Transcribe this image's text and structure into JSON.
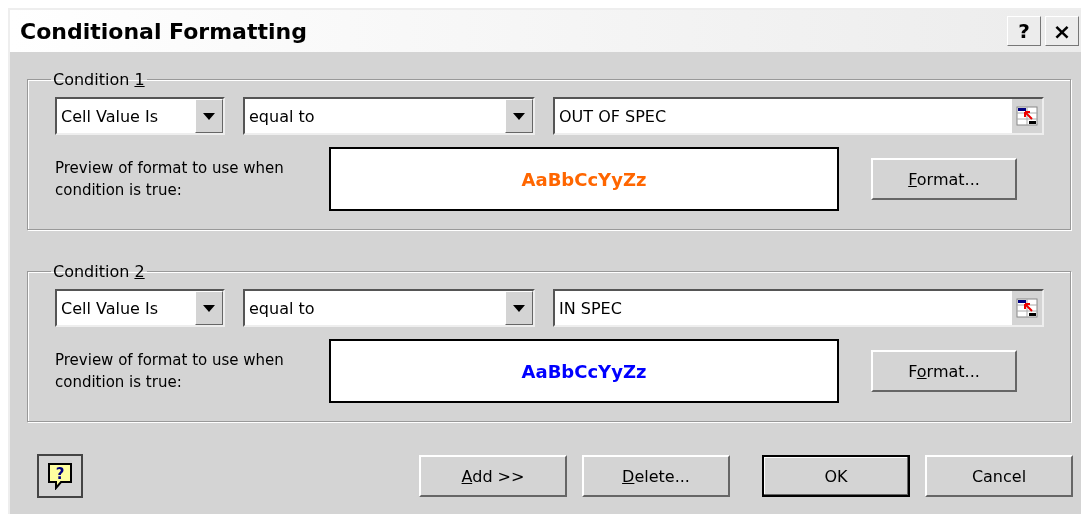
{
  "window": {
    "title": "Conditional Formatting"
  },
  "title_buttons": [
    {
      "kind": "help",
      "label": "?"
    },
    {
      "kind": "close",
      "label": "×"
    }
  ],
  "conditions": [
    {
      "title": "Condition ",
      "title_key": "1",
      "type": "Cell Value Is",
      "operator": "equal to",
      "value": "OUT OF SPEC",
      "preview_label": "Preview of format to use when condition is true:",
      "preview_text": "AaBbCcYyZz",
      "color": "#ff6600",
      "format_button": {
        "key": "F",
        "rest": "ormat..."
      }
    },
    {
      "title": "Condition ",
      "title_key": "2",
      "type": "Cell Value Is",
      "operator": "equal to",
      "value": "IN SPEC",
      "preview_label": "Preview of format to use when condition is true:",
      "preview_text": "AaBbCcYyZz",
      "color": "#0000ff",
      "format_button": {
        "lead": "F",
        "key": "o",
        "rest": "rmat..."
      }
    }
  ],
  "help_button": {
    "glyph": "?"
  },
  "buttons": [
    {
      "key": "A",
      "rest": "dd >>",
      "default": false
    },
    {
      "key": "D",
      "rest": "elete...",
      "default": false
    },
    {
      "lead": "OK",
      "default": true
    },
    {
      "lead": "Cancel",
      "default": false
    }
  ]
}
